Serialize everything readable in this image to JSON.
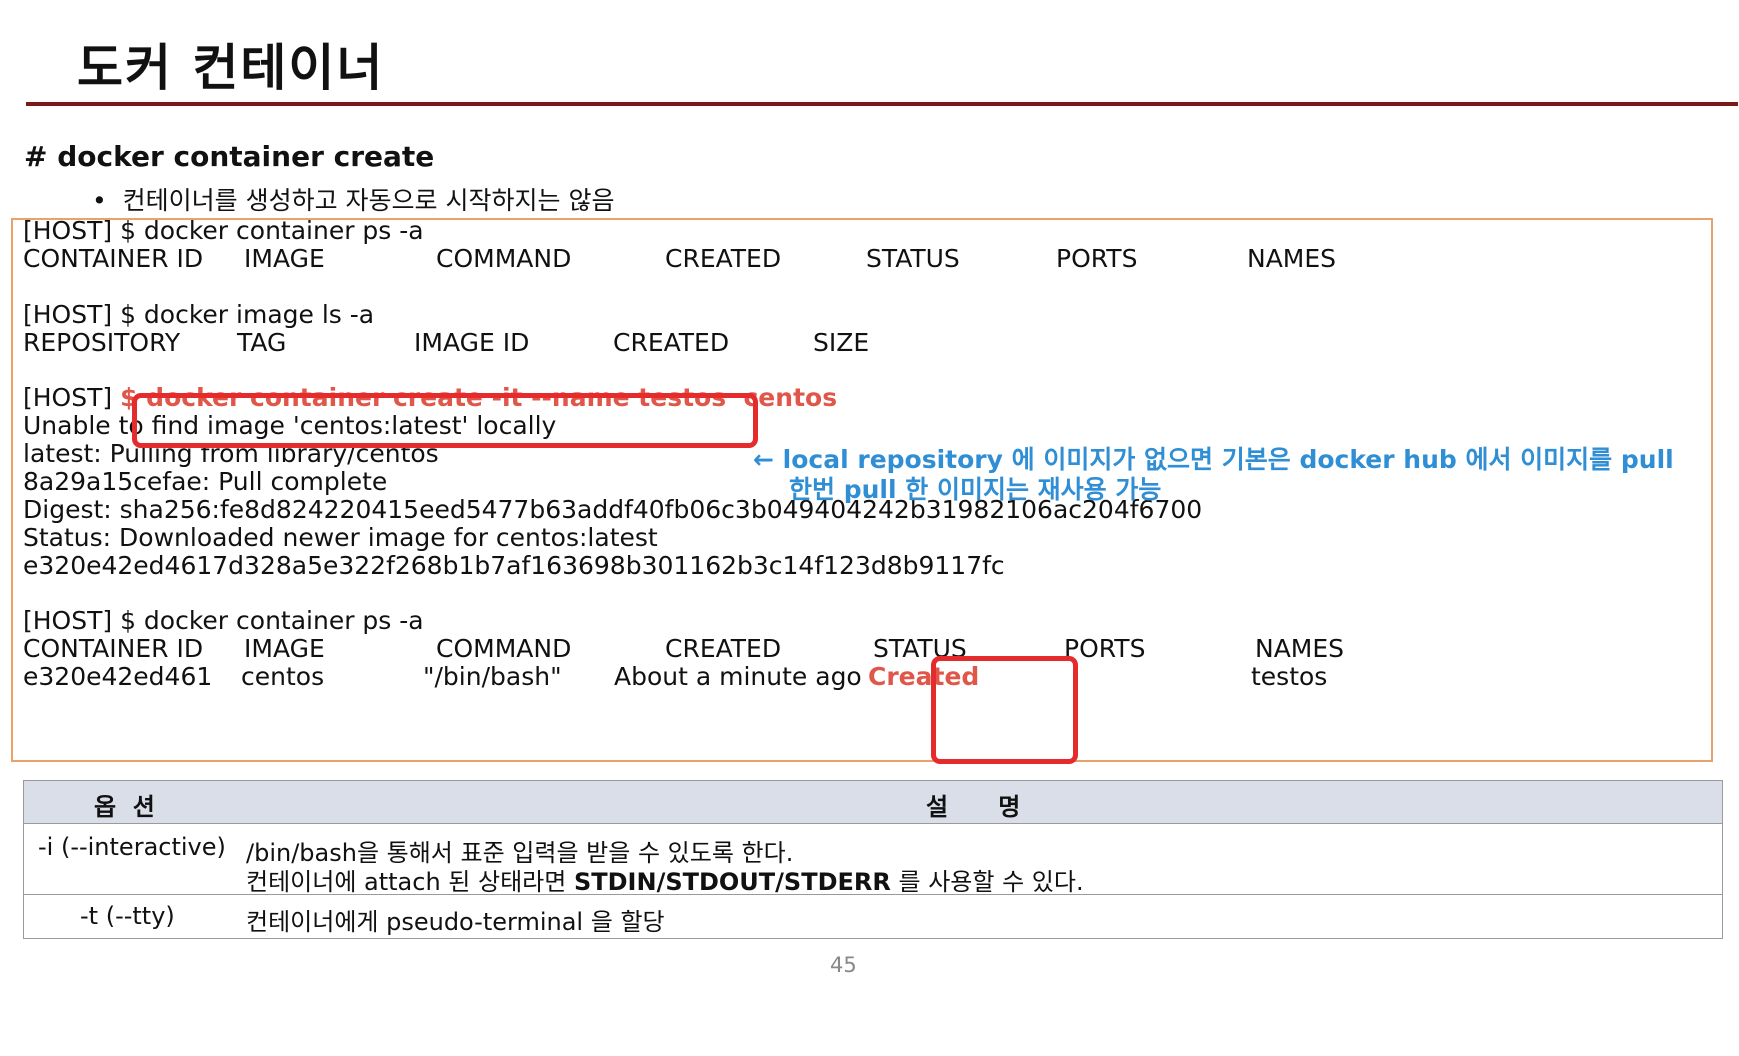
{
  "slide": {
    "title": "도커 컨테이너",
    "section_heading": "# docker container create",
    "bullet_marker": "•",
    "bullet": "컨테이너를 생성하고 자동으로 시작하지는 않음",
    "page_number": "45"
  },
  "terminal": {
    "ps1": {
      "cmd": "[HOST] $ docker container ps -a",
      "headers": [
        "CONTAINER ID",
        "IMAGE",
        "COMMAND",
        "CREATED",
        "STATUS",
        "PORTS",
        "NAMES"
      ]
    },
    "ls": {
      "cmd": "[HOST] $ docker image ls -a",
      "headers": [
        "REPOSITORY",
        "TAG",
        "IMAGE ID",
        "CREATED",
        "SIZE"
      ]
    },
    "create": {
      "prompt": "[HOST] ",
      "command": "$ docker container create -it --name testos  centos",
      "output": [
        "Unable to find image 'centos:latest' locally",
        "latest: Pulling from library/centos",
        "8a29a15cefae: Pull complete",
        "Digest: sha256:fe8d824220415eed5477b63addf40fb06c3b049404242b31982106ac204f6700",
        "Status: Downloaded newer image for centos:latest",
        "e320e42ed4617d328a5e322f268b1b7af163698b301162b3c14f123d8b9117fc"
      ]
    },
    "ps2": {
      "cmd": "[HOST] $ docker container ps -a",
      "headers": [
        "CONTAINER ID",
        "IMAGE",
        "COMMAND",
        "CREATED",
        "STATUS",
        "PORTS",
        "NAMES"
      ],
      "row": [
        "e320e42ed461",
        "centos",
        "\"/bin/bash\"",
        "About a minute ago",
        "Created",
        "",
        "testos"
      ]
    }
  },
  "annotation": {
    "arrow": "←",
    "line1": "local repository 에 이미지가 없으면 기본은 docker hub 에서 이미지를 pull",
    "line2": "한번 pull 한 이미지는 재사용 가능"
  },
  "options_table": {
    "header_option": "옵  션",
    "header_desc": "설      명",
    "rows": [
      {
        "option": "-i (--interactive)",
        "desc1": "/bin/bash을 통해서 표준 입력을 받을 수 있도록 한다.",
        "desc2_pre": "컨테이너에 attach 된 상태라면 ",
        "desc2_bold": "STDIN/STDOUT/STDERR",
        "desc2_post": " 를 사용할 수 있다."
      },
      {
        "option": "-t (--tty)",
        "desc1": "컨테이너에게 pseudo-terminal 을 할당"
      }
    ]
  },
  "colors": {
    "title_rule": "#7a1a1a",
    "terminal_border": "#e9a26b",
    "highlight_border": "#e52b2b",
    "highlight_text": "#e0574a",
    "annotation_text": "#2f8ed4",
    "table_header_bg": "#d9dee9"
  }
}
